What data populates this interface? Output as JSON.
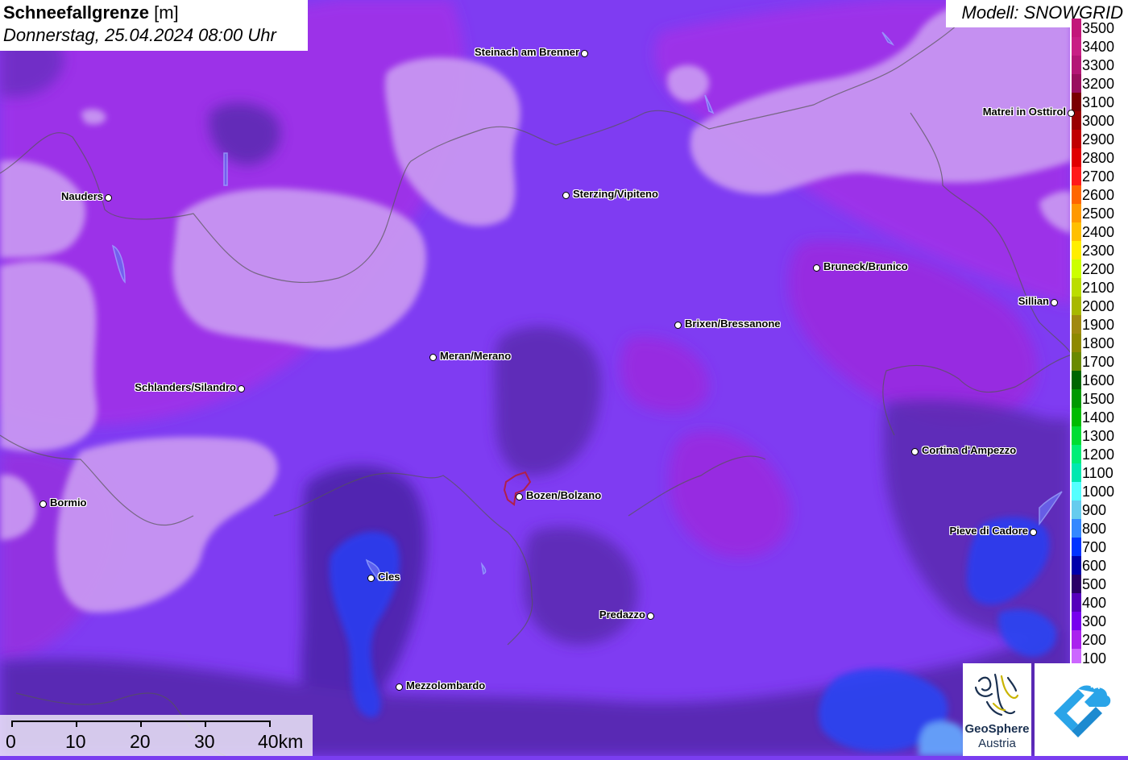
{
  "title": {
    "main": "Schneefallgrenze",
    "unit": "[m]",
    "datetime": "Donnerstag, 25.04.2024 08:00 Uhr"
  },
  "model": "Modell: SNOWGRID",
  "legend": [
    {
      "label": "3500",
      "color": "#c2177a"
    },
    {
      "label": "3400",
      "color": "#c81f85"
    },
    {
      "label": "3300",
      "color": "#b41676"
    },
    {
      "label": "3200",
      "color": "#990f5e"
    },
    {
      "label": "3100",
      "color": "#7a0000"
    },
    {
      "label": "3000",
      "color": "#990000"
    },
    {
      "label": "2900",
      "color": "#c00000"
    },
    {
      "label": "2800",
      "color": "#e00000"
    },
    {
      "label": "2700",
      "color": "#ff1a1a"
    },
    {
      "label": "2600",
      "color": "#ff6600"
    },
    {
      "label": "2500",
      "color": "#ff9900"
    },
    {
      "label": "2400",
      "color": "#ffc000"
    },
    {
      "label": "2300",
      "color": "#ffee00"
    },
    {
      "label": "2200",
      "color": "#ccff00"
    },
    {
      "label": "2100",
      "color": "#bbdd00"
    },
    {
      "label": "2000",
      "color": "#a8b800"
    },
    {
      "label": "1900",
      "color": "#a08a10"
    },
    {
      "label": "1800",
      "color": "#8e8a00"
    },
    {
      "label": "1700",
      "color": "#6a8a00"
    },
    {
      "label": "1600",
      "color": "#006600"
    },
    {
      "label": "1500",
      "color": "#009900"
    },
    {
      "label": "1400",
      "color": "#00bb00"
    },
    {
      "label": "1300",
      "color": "#00dd33"
    },
    {
      "label": "1200",
      "color": "#00ee77"
    },
    {
      "label": "1100",
      "color": "#00e8b0"
    },
    {
      "label": "1000",
      "color": "#55ffff"
    },
    {
      "label": "900",
      "color": "#66ccee"
    },
    {
      "label": "800",
      "color": "#3388ff"
    },
    {
      "label": "700",
      "color": "#0033ff"
    },
    {
      "label": "600",
      "color": "#0000aa"
    },
    {
      "label": "500",
      "color": "#2a0066"
    },
    {
      "label": "400",
      "color": "#5500bb"
    },
    {
      "label": "300",
      "color": "#7700ee"
    },
    {
      "label": "200",
      "color": "#aa22ee"
    },
    {
      "label": "100",
      "color": "#cc66ff"
    }
  ],
  "cities": [
    {
      "name": "Steinach am Brenner",
      "label_side": "left"
    },
    {
      "name": "Matrei in Osttirol",
      "label_side": "left"
    },
    {
      "name": "Nauders",
      "label_side": "left"
    },
    {
      "name": "Sterzing/Vipiteno",
      "label_side": "right"
    },
    {
      "name": "Bruneck/Brunico",
      "label_side": "right"
    },
    {
      "name": "Sillian",
      "label_side": "left"
    },
    {
      "name": "Brixen/Bressanone",
      "label_side": "right"
    },
    {
      "name": "Meran/Merano",
      "label_side": "right"
    },
    {
      "name": "Schlanders/Silandro",
      "label_side": "left"
    },
    {
      "name": "Cortina d'Ampezzo",
      "label_side": "right"
    },
    {
      "name": "Bormio",
      "label_side": "right"
    },
    {
      "name": "Bozen/Bolzano",
      "label_side": "right"
    },
    {
      "name": "Pieve di Cadore",
      "label_side": "left"
    },
    {
      "name": "Cles",
      "label_side": "right"
    },
    {
      "name": "Predazzo",
      "label_side": "left"
    },
    {
      "name": "Mezzolombardo",
      "label_side": "right"
    }
  ],
  "scale": {
    "labels": [
      "0",
      "10",
      "20",
      "30",
      "40km"
    ]
  },
  "logos": {
    "geosphere_line1": "GeoSphere",
    "geosphere_line2": "Austria"
  },
  "icons": [
    "geosphere-logo-icon",
    "cloud-arrow-logo-icon"
  ]
}
